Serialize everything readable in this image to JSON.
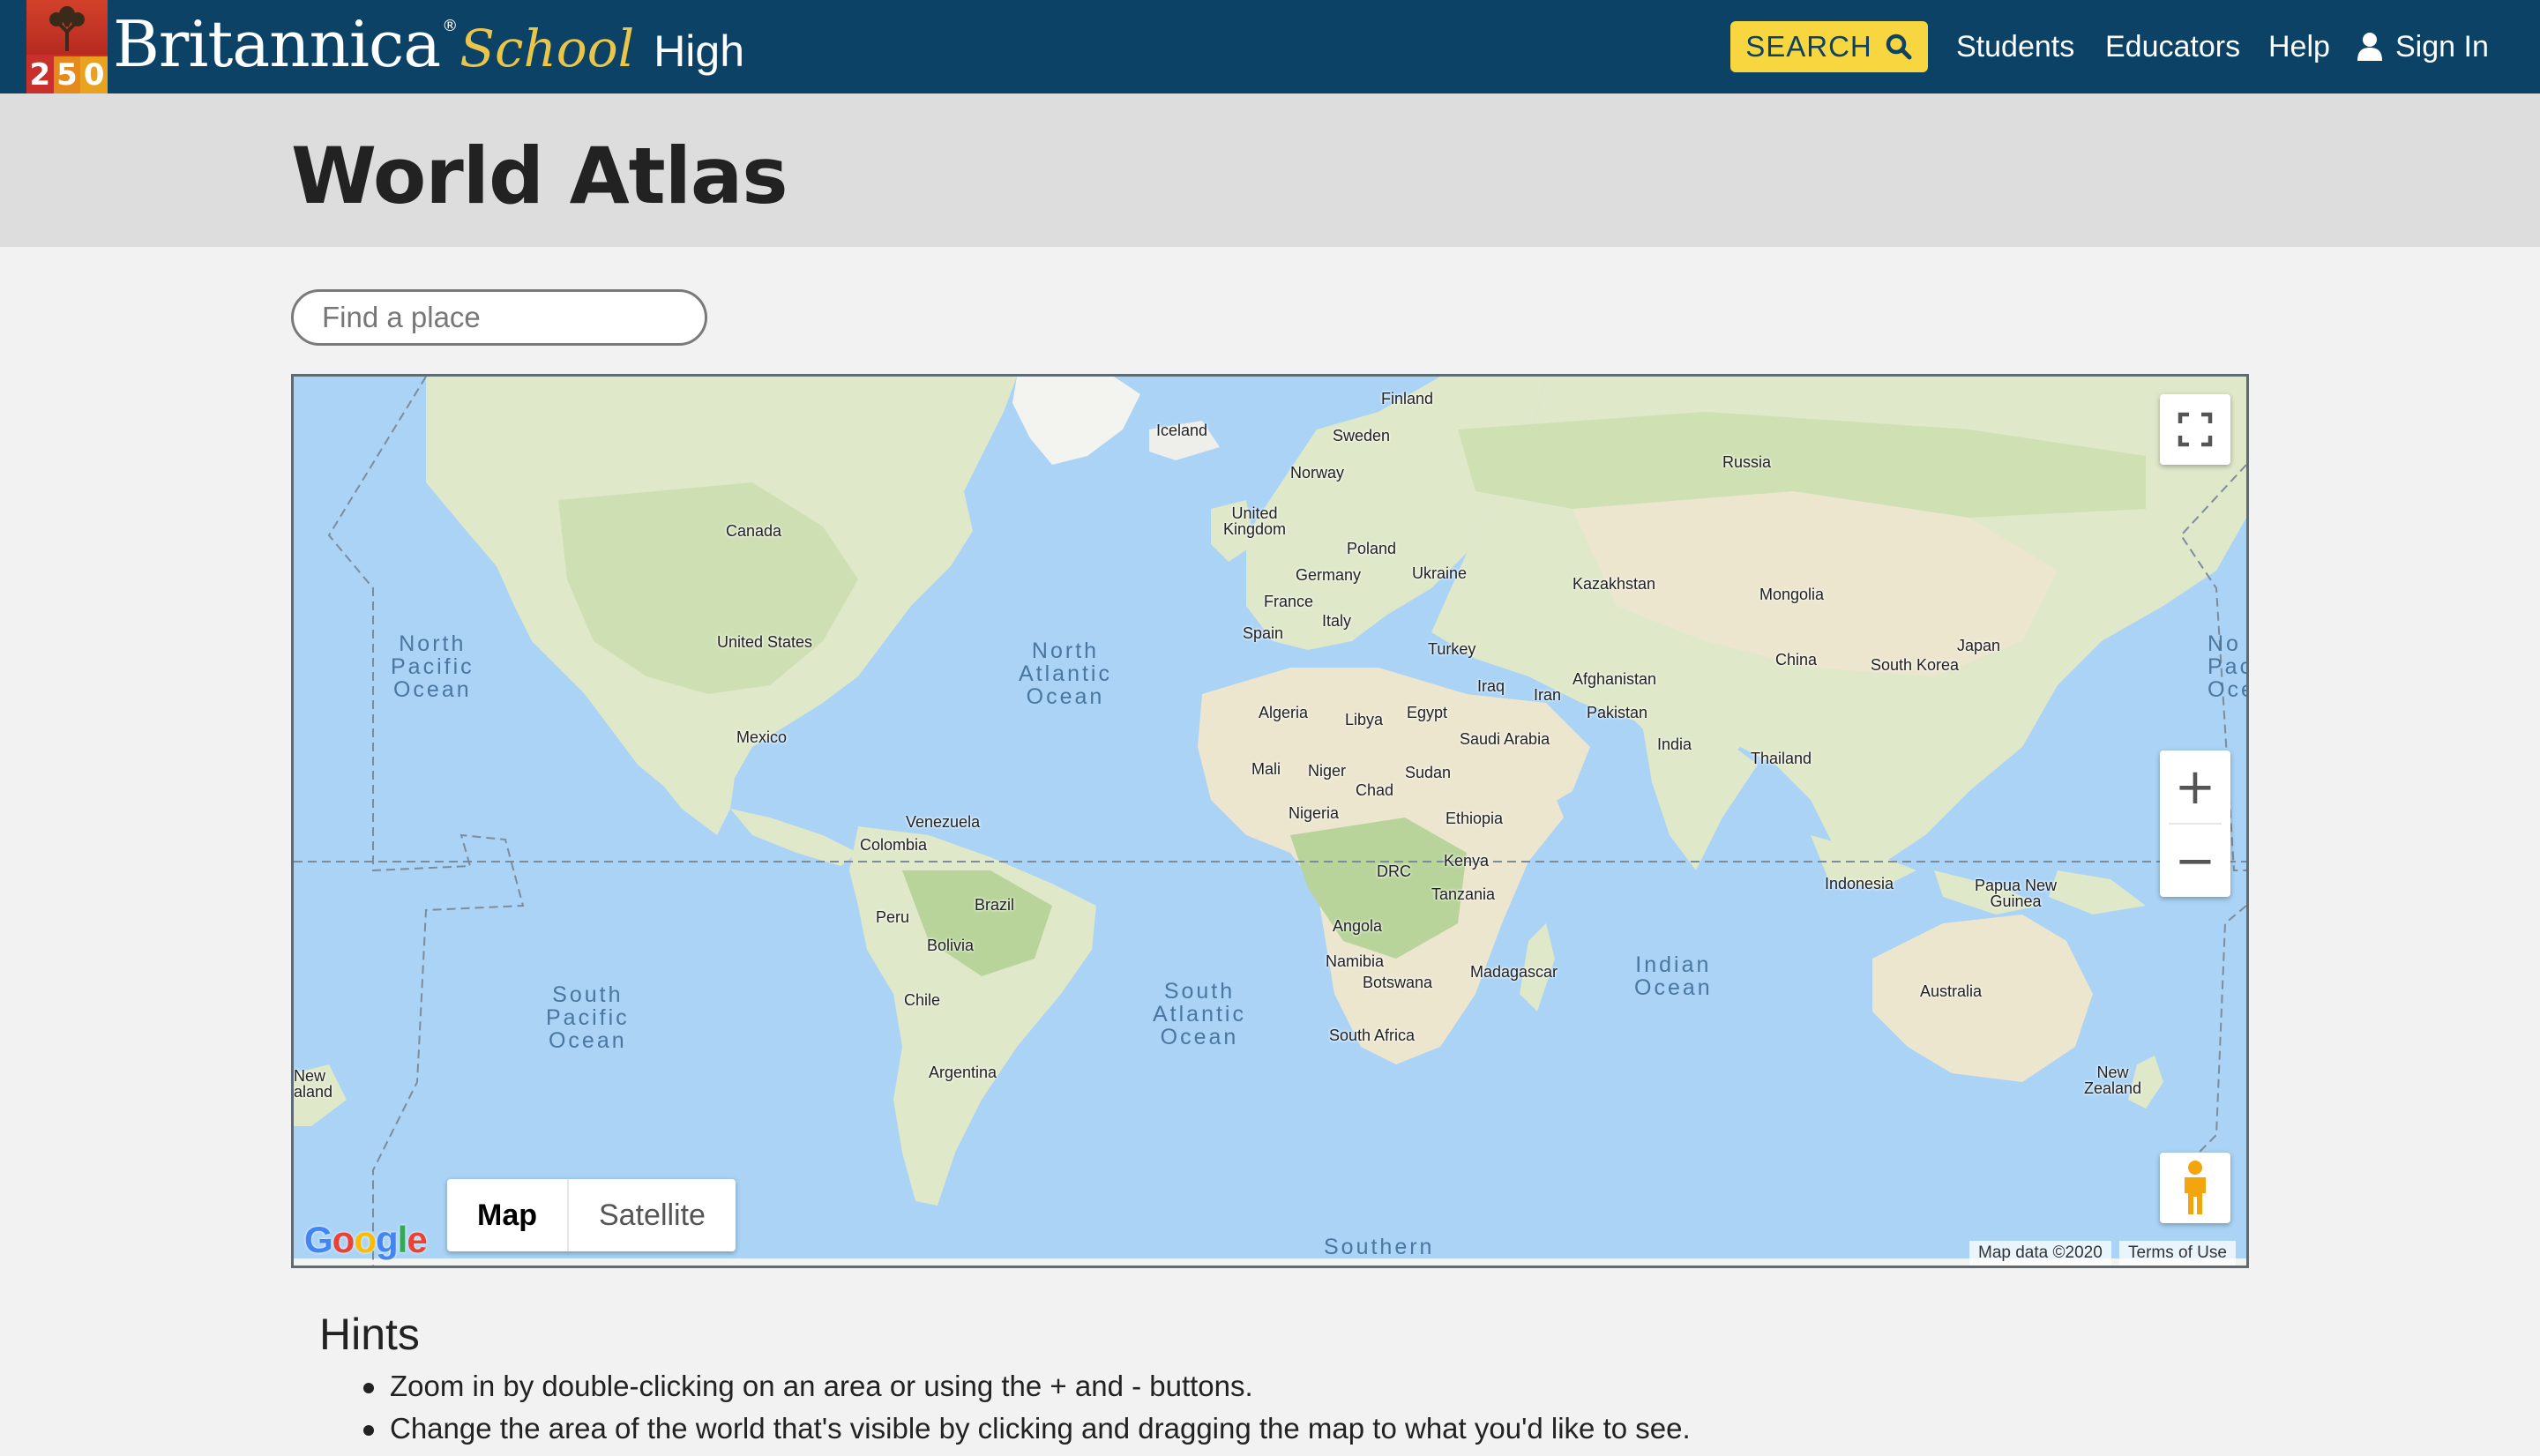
{
  "header": {
    "logo_number": [
      "2",
      "5",
      "0"
    ],
    "brand_main": "Britannica",
    "brand_reg": "®",
    "brand_school": "School",
    "brand_level": "High",
    "search_label": "SEARCH",
    "nav": {
      "students": "Students",
      "educators": "Educators",
      "help": "Help",
      "signin": "Sign In"
    },
    "colors": {
      "bar": "#0b4266",
      "search": "#f7d63f",
      "school": "#e9c64a"
    }
  },
  "page": {
    "title": "World Atlas",
    "find_placeholder": "Find a place"
  },
  "map": {
    "countries": {
      "finland": "Finland",
      "iceland": "Iceland",
      "sweden": "Sweden",
      "norway": "Norway",
      "russia": "Russia",
      "uk": "United\nKingdom",
      "poland": "Poland",
      "germany": "Germany",
      "ukraine": "Ukraine",
      "kazakhstan": "Kazakhstan",
      "france": "France",
      "italy": "Italy",
      "mongolia": "Mongolia",
      "spain": "Spain",
      "turkey": "Turkey",
      "japan": "Japan",
      "china": "China",
      "south_korea": "South Korea",
      "afghanistan": "Afghanistan",
      "iraq": "Iraq",
      "iran": "Iran",
      "pakistan": "Pakistan",
      "algeria": "Algeria",
      "libya": "Libya",
      "egypt": "Egypt",
      "saudi_arabia": "Saudi Arabia",
      "india": "India",
      "thailand": "Thailand",
      "mali": "Mali",
      "niger": "Niger",
      "sudan": "Sudan",
      "chad": "Chad",
      "nigeria": "Nigeria",
      "ethiopia": "Ethiopia",
      "kenya": "Kenya",
      "drc": "DRC",
      "tanzania": "Tanzania",
      "indonesia": "Indonesia",
      "papua": "Papua New\nGuinea",
      "angola": "Angola",
      "namibia": "Namibia",
      "botswana": "Botswana",
      "madagascar": "Madagascar",
      "australia": "Australia",
      "south_africa": "South Africa",
      "new_zealand": "New\nZealand",
      "new_zealand_left": "New\naland",
      "canada": "Canada",
      "united_states": "United States",
      "mexico": "Mexico",
      "venezuela": "Venezuela",
      "colombia": "Colombia",
      "brazil": "Brazil",
      "peru": "Peru",
      "bolivia": "Bolivia",
      "chile": "Chile",
      "argentina": "Argentina"
    },
    "oceans": {
      "north_pacific": "North\nPacific\nOcean",
      "north_pacific_right": "No\nPac\nOce",
      "north_atlantic": "North\nAtlantic\nOcean",
      "south_pacific": "South\nPacific\nOcean",
      "south_atlantic": "South\nAtlantic\nOcean",
      "indian": "Indian\nOcean",
      "southern": "Southern"
    },
    "map_type": {
      "map": "Map",
      "satellite": "Satellite",
      "selected": "Map"
    },
    "attribution": {
      "data": "Map data ©2020",
      "terms": "Terms of Use"
    },
    "zoom_in": "+",
    "zoom_out": "−",
    "google": [
      "G",
      "o",
      "o",
      "g",
      "l",
      "e"
    ],
    "icons": [
      "fullscreen-icon",
      "zoom-in-icon",
      "zoom-out-icon",
      "pegman-icon"
    ]
  },
  "hints": {
    "title": "Hints",
    "items": [
      "Zoom in by double-clicking on an area or using the + and - buttons.",
      "Change the area of the world that's visible by clicking and dragging the map to what you'd like to see."
    ]
  }
}
